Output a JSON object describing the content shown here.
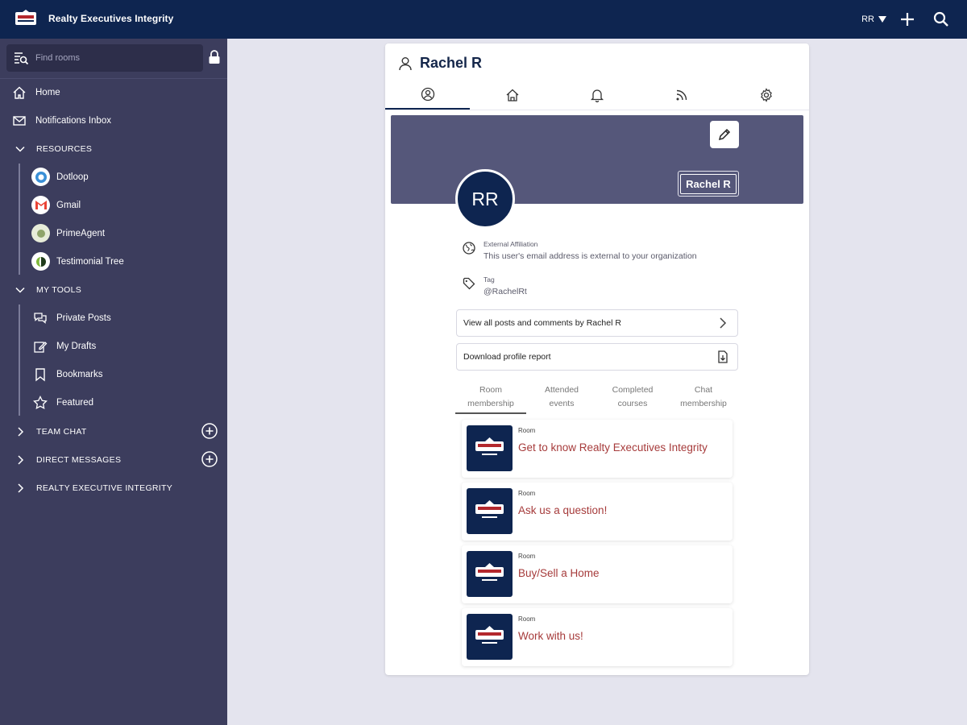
{
  "header": {
    "brand_name": "Realty Executives Integrity",
    "user_initials": "RR",
    "colors": {
      "topbar": "#0e2550",
      "sidebar": "#3c3d5d",
      "accent_link": "#a63b3b"
    }
  },
  "sidebar": {
    "search_placeholder": "Find rooms",
    "home": "Home",
    "notifications": "Notifications Inbox",
    "resources": {
      "title": "RESOURCES",
      "items": [
        {
          "label": "Dotloop",
          "icon": "dotloop-icon"
        },
        {
          "label": "Gmail",
          "icon": "gmail-icon"
        },
        {
          "label": "PrimeAgent",
          "icon": "primeagent-icon"
        },
        {
          "label": "Testimonial Tree",
          "icon": "testimonial-tree-icon"
        }
      ]
    },
    "my_tools": {
      "title": "MY TOOLS",
      "items": [
        {
          "label": "Private Posts",
          "icon": "chat-bubbles-icon"
        },
        {
          "label": "My Drafts",
          "icon": "edit-note-icon"
        },
        {
          "label": "Bookmarks",
          "icon": "bookmark-icon"
        },
        {
          "label": "Featured",
          "icon": "star-icon"
        }
      ]
    },
    "team_chat": "TEAM CHAT",
    "direct_messages": "DIRECT MESSAGES",
    "realty_executive": "REALTY EXECUTIVE INTEGRITY"
  },
  "profile": {
    "name": "Rachel R",
    "initials": "RR",
    "badge_name": "Rachel R",
    "external_affiliation_label": "External Affiliation",
    "external_affiliation_text": "This user's email address is external to your organization",
    "tag_label": "Tag",
    "tag_value": "@RachelRt",
    "view_posts": "View all posts and comments by Rachel R",
    "download_report": "Download profile report",
    "subtabs": [
      {
        "line1": "Room",
        "line2": "membership"
      },
      {
        "line1": "Attended",
        "line2": "events"
      },
      {
        "line1": "Completed",
        "line2": "courses"
      },
      {
        "line1": "Chat",
        "line2": "membership"
      }
    ],
    "rooms": [
      {
        "type": "Room",
        "name": "Get to know Realty Executives Integrity"
      },
      {
        "type": "Room",
        "name": "Ask us a question!"
      },
      {
        "type": "Room",
        "name": "Buy/Sell a Home"
      },
      {
        "type": "Room",
        "name": "Work with us!"
      }
    ]
  }
}
